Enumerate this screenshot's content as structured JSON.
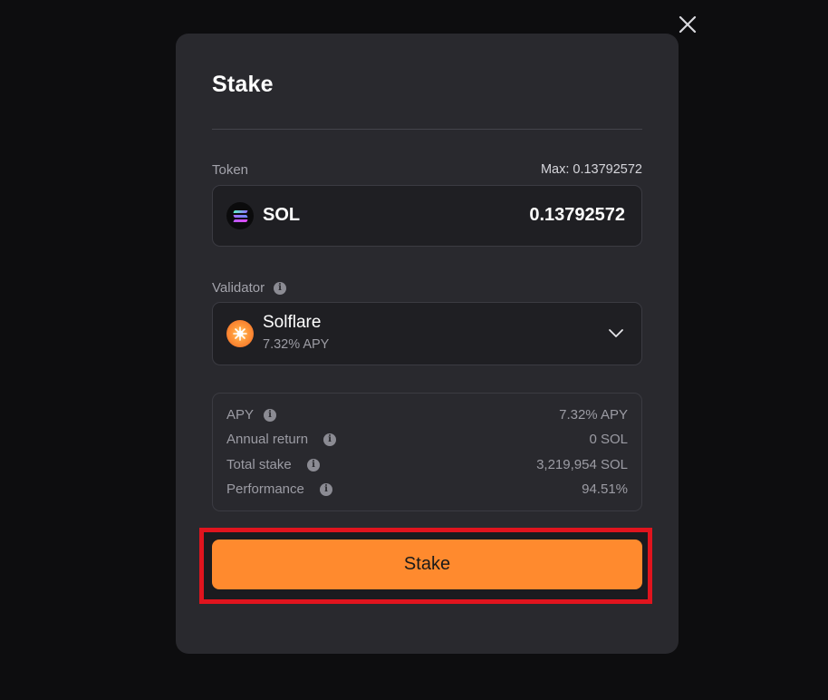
{
  "modal": {
    "title": "Stake",
    "close_icon": "close-icon"
  },
  "token": {
    "label": "Token",
    "max_text": "Max: 0.13792572",
    "name": "SOL",
    "amount": "0.13792572",
    "icon": "solana-logo-icon"
  },
  "validator": {
    "label": "Validator",
    "name": "Solflare",
    "apy": "7.32% APY",
    "icon": "solflare-logo-icon",
    "dropdown_icon": "chevron-down-icon"
  },
  "stats": [
    {
      "label": "APY",
      "value": "7.32% APY"
    },
    {
      "label": "Annual return",
      "value": "0 SOL"
    },
    {
      "label": "Total stake",
      "value": "3,219,954 SOL"
    },
    {
      "label": "Performance",
      "value": "94.51%"
    }
  ],
  "actions": {
    "stake_label": "Stake"
  },
  "colors": {
    "accent": "#ff8a2e",
    "highlight_border": "#e0141e",
    "modal_bg": "#29292e",
    "page_bg": "#0d0d0f"
  }
}
